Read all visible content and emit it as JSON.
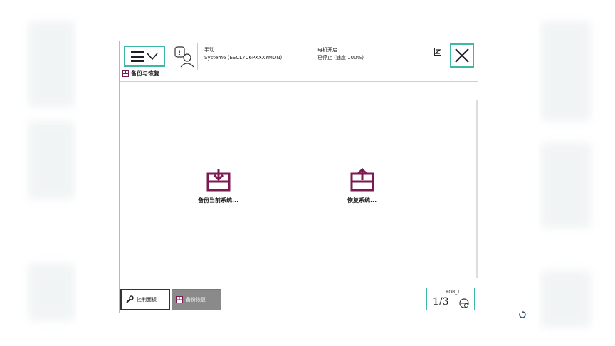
{
  "colors": {
    "accent": "#3eb7a7",
    "icon_maroon": "#7a1a50",
    "disabled_tab": "#8a8a8a"
  },
  "header": {
    "menu_icon": "hamburger-menu-icon",
    "mode": "手动",
    "system": "System6 (ESCL7C6PXXXYMDN)",
    "motor": "电机开启",
    "run_state": "已停止 (速度 100%)",
    "close_icon": "close-icon"
  },
  "page": {
    "title": "备份与恢复"
  },
  "actions": {
    "backup_label": "备份当前系统...",
    "restore_label": "恢复系统..."
  },
  "taskbar": {
    "control_panel": "控制面板",
    "backup_restore": "备份恢复"
  },
  "status": {
    "rob_label": "ROB_1",
    "ratio": "1/3"
  }
}
